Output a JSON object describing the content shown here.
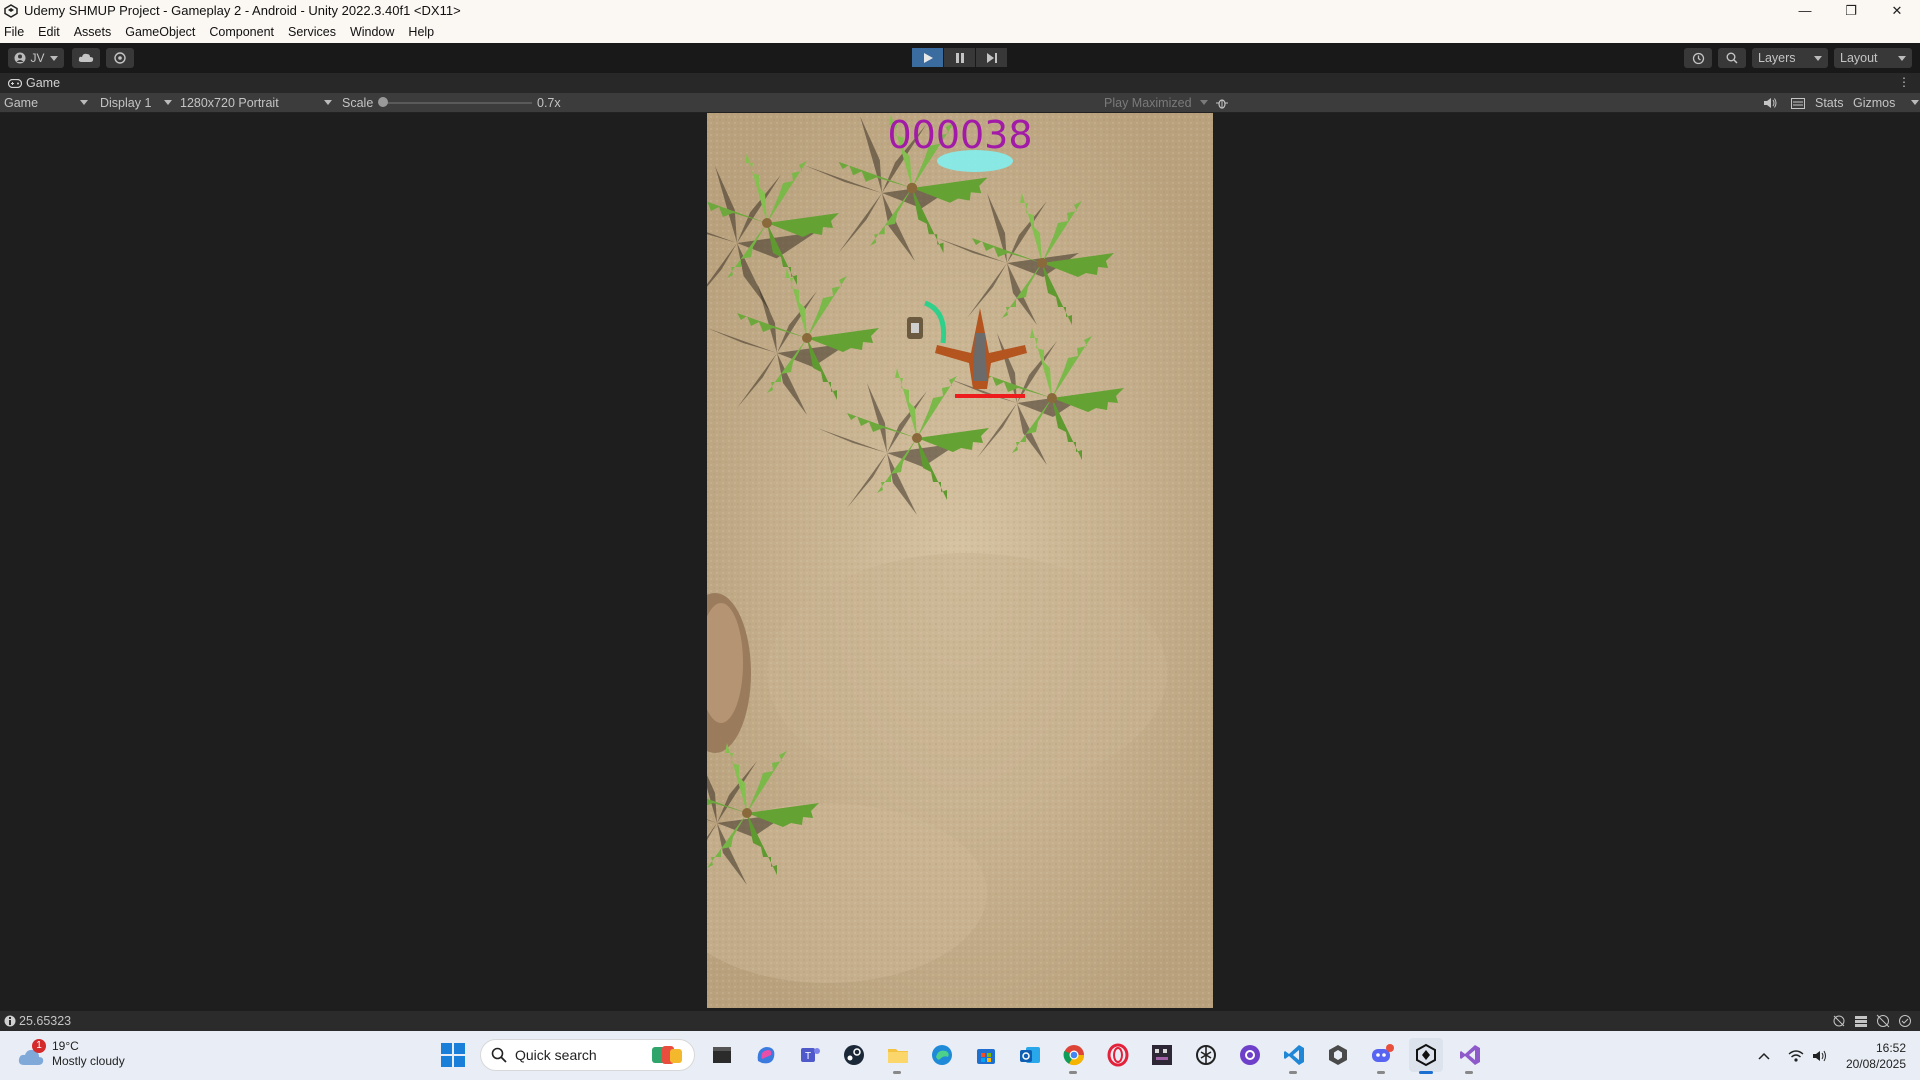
{
  "window": {
    "title": "Udemy SHMUP Project - Gameplay 2 - Android - Unity 2022.3.40f1 <DX11>",
    "minimize": "—",
    "restore": "❐",
    "close": "✕"
  },
  "menu": [
    "File",
    "Edit",
    "Assets",
    "GameObject",
    "Component",
    "Services",
    "Window",
    "Help"
  ],
  "toolbar": {
    "account": "JV",
    "layers": "Layers",
    "layout": "Layout"
  },
  "tab": {
    "label": "Game"
  },
  "gamebar": {
    "view_mode": "Game",
    "display": "Display 1",
    "resolution": "1280x720 Portrait",
    "scale_label": "Scale",
    "scale_value": "0.7x",
    "scale_fraction": 0.0,
    "play_mode": "Play Maximized",
    "stats": "Stats",
    "gizmos": "Gizmos"
  },
  "game": {
    "score": "000038"
  },
  "status": {
    "message": "25.65323"
  },
  "taskbar": {
    "weather_badge": "1",
    "temperature": "19°C",
    "condition": "Mostly cloudy",
    "search_placeholder": "Quick search",
    "time": "16:52",
    "date": "20/08/2025",
    "apps": [
      "explorer-icon",
      "copilot-icon",
      "teams-icon",
      "steam-icon",
      "file-explorer-icon",
      "edge-icon",
      "store-icon",
      "outlook-icon",
      "chrome-icon",
      "opera-icon",
      "aseprite-icon",
      "chatgpt-icon",
      "github-desktop-icon",
      "vscode-icon",
      "unity-hub-icon",
      "discord-icon",
      "unity-icon",
      "visual-studio-icon"
    ]
  }
}
